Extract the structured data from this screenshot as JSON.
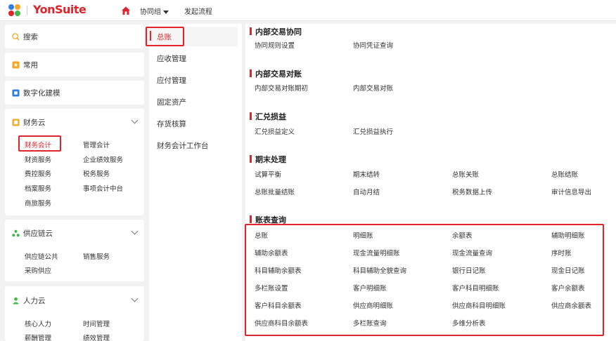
{
  "header": {
    "brand": "YonSuite",
    "group": "协同组",
    "flow": "发起流程"
  },
  "sidebar": {
    "search": "搜索",
    "common": "常用",
    "digital": "数字化建模",
    "finance": {
      "title": "财务云",
      "items": [
        "财务会计",
        "管理会计",
        "财资服务",
        "企业绩效服务",
        "费控服务",
        "税务服务",
        "档案服务",
        "事项会计中台",
        "商旅服务"
      ]
    },
    "supply": {
      "title": "供应链云",
      "items": [
        "供应链公共",
        "销售服务",
        "采购供应"
      ]
    },
    "hr": {
      "title": "人力云",
      "items": [
        "核心人力",
        "时间管理",
        "薪酬管理",
        "绩效管理"
      ]
    }
  },
  "middle": {
    "items": [
      "总账",
      "应收管理",
      "应付管理",
      "固定资产",
      "存货核算",
      "财务会计工作台"
    ]
  },
  "content": {
    "sections": [
      {
        "title": "内部交易协同",
        "items": [
          "协同规则设置",
          "协同凭证查询"
        ]
      },
      {
        "title": "内部交易对账",
        "items": [
          "内部交易对账期初",
          "内部交易对账"
        ]
      },
      {
        "title": "汇兑损益",
        "items": [
          "汇兑损益定义",
          "汇兑损益执行"
        ]
      },
      {
        "title": "期末处理",
        "items": [
          "试算平衡",
          "期末结转",
          "总账关账",
          "总账结账",
          "总账批量结账",
          "自动月结",
          "税务数据上传",
          "审计信息导出"
        ]
      },
      {
        "title": "账表查询",
        "items": [
          "总账",
          "明细账",
          "余额表",
          "辅助明细账",
          "辅助余额表",
          "现金流量明细账",
          "现金流量查询",
          "序时账",
          "科目辅助余额表",
          "科目辅助全貌查询",
          "银行日记账",
          "现金日记账",
          "多栏账设置",
          "客户明细账",
          "客户科目明细账",
          "客户余额表",
          "客户科目余额表",
          "供应商明细账",
          "供应商科目明细账",
          "供应商余额表",
          "供应商科目余额表",
          "多栏账查询",
          "多维分析表"
        ]
      }
    ]
  },
  "colors": {
    "accent": "#e0242b",
    "panel": "#ffffff",
    "background": "#f2f2f2"
  }
}
